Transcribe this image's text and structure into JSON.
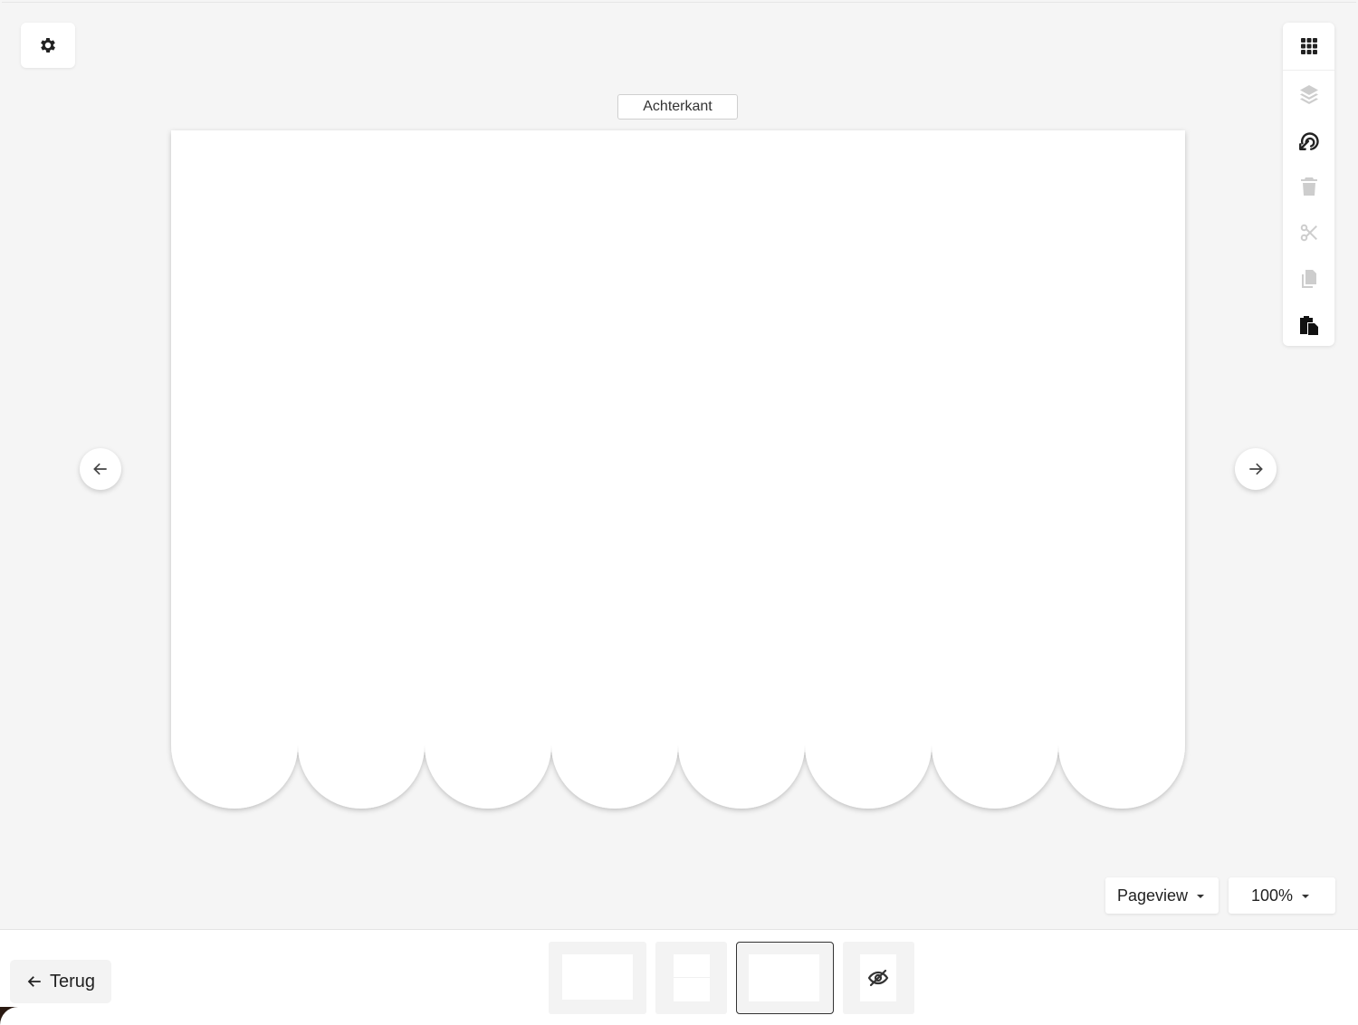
{
  "canvas": {
    "side_label": "Achterkant",
    "scallop_count": 8
  },
  "toolbar": {
    "tools": [
      {
        "name": "grid-icon",
        "enabled": true
      },
      {
        "name": "layers-icon",
        "enabled": false
      },
      {
        "name": "arrange-icon",
        "enabled": true
      },
      {
        "name": "trash-icon",
        "enabled": false
      },
      {
        "name": "scissors-icon",
        "enabled": false
      },
      {
        "name": "copy-icon",
        "enabled": false
      },
      {
        "name": "paste-icon",
        "enabled": true
      }
    ]
  },
  "view": {
    "mode_label": "Pageview",
    "zoom_label": "100%"
  },
  "footer": {
    "back_label": "Terug"
  },
  "pages": {
    "selected_index": 2,
    "thumbnails": [
      "front",
      "inside",
      "back",
      "hidden"
    ]
  },
  "colors": {
    "background": "#f5f5f5",
    "panel": "#ffffff",
    "icon": "#222222"
  }
}
